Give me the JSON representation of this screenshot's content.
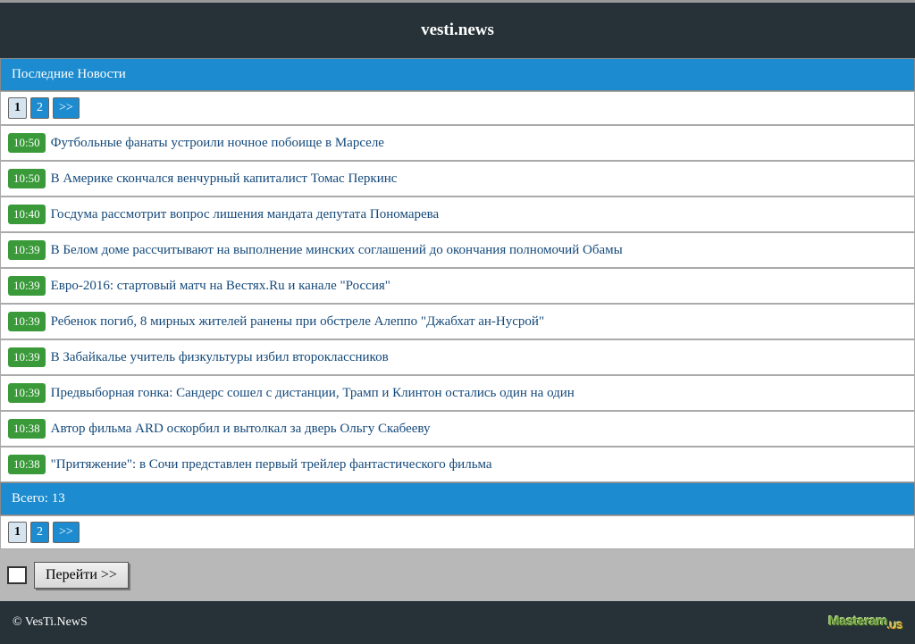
{
  "site_title": "vesti.news",
  "section_title": "Последние Новости",
  "pager": {
    "current": "1",
    "other": "2",
    "next": ">>"
  },
  "news": [
    {
      "time": "10:50",
      "title": "Футбольные фанаты устроили ночное побоище в Марселе"
    },
    {
      "time": "10:50",
      "title": "В Америке скончался венчурный капиталист Томас Перкинс"
    },
    {
      "time": "10:40",
      "title": "Госдума рассмотрит вопрос лишения мандата депутата Пономарева"
    },
    {
      "time": "10:39",
      "title": "В Белом доме рассчитывают на выполнение минских соглашений до окончания полномочий Обамы"
    },
    {
      "time": "10:39",
      "title": "Евро-2016: стартовый матч на Вестях.Ru и канале \"Россия\""
    },
    {
      "time": "10:39",
      "title": "Ребенок погиб, 8 мирных жителей ранены при обстреле Алеппо \"Джабхат ан-Нусрой\""
    },
    {
      "time": "10:39",
      "title": "В Забайкалье учитель физкультуры избил второклассников"
    },
    {
      "time": "10:39",
      "title": "Предвыборная гонка: Сандерс сошел с дистанции, Трамп и Клинтон остались один на один"
    },
    {
      "time": "10:38",
      "title": "Автор фильма ARD оскорбил и вытолкал за дверь Ольгу Скабееву"
    },
    {
      "time": "10:38",
      "title": "\"Притяжение\": в Сочи представлен первый трейлер фантастического фильма"
    }
  ],
  "total_label": "Всего: 13",
  "goto_button": "Перейти >>",
  "footer_copyright": "© VesTi.NewS",
  "footer_logo_main": "Masteram",
  "footer_logo_sub": ".US"
}
